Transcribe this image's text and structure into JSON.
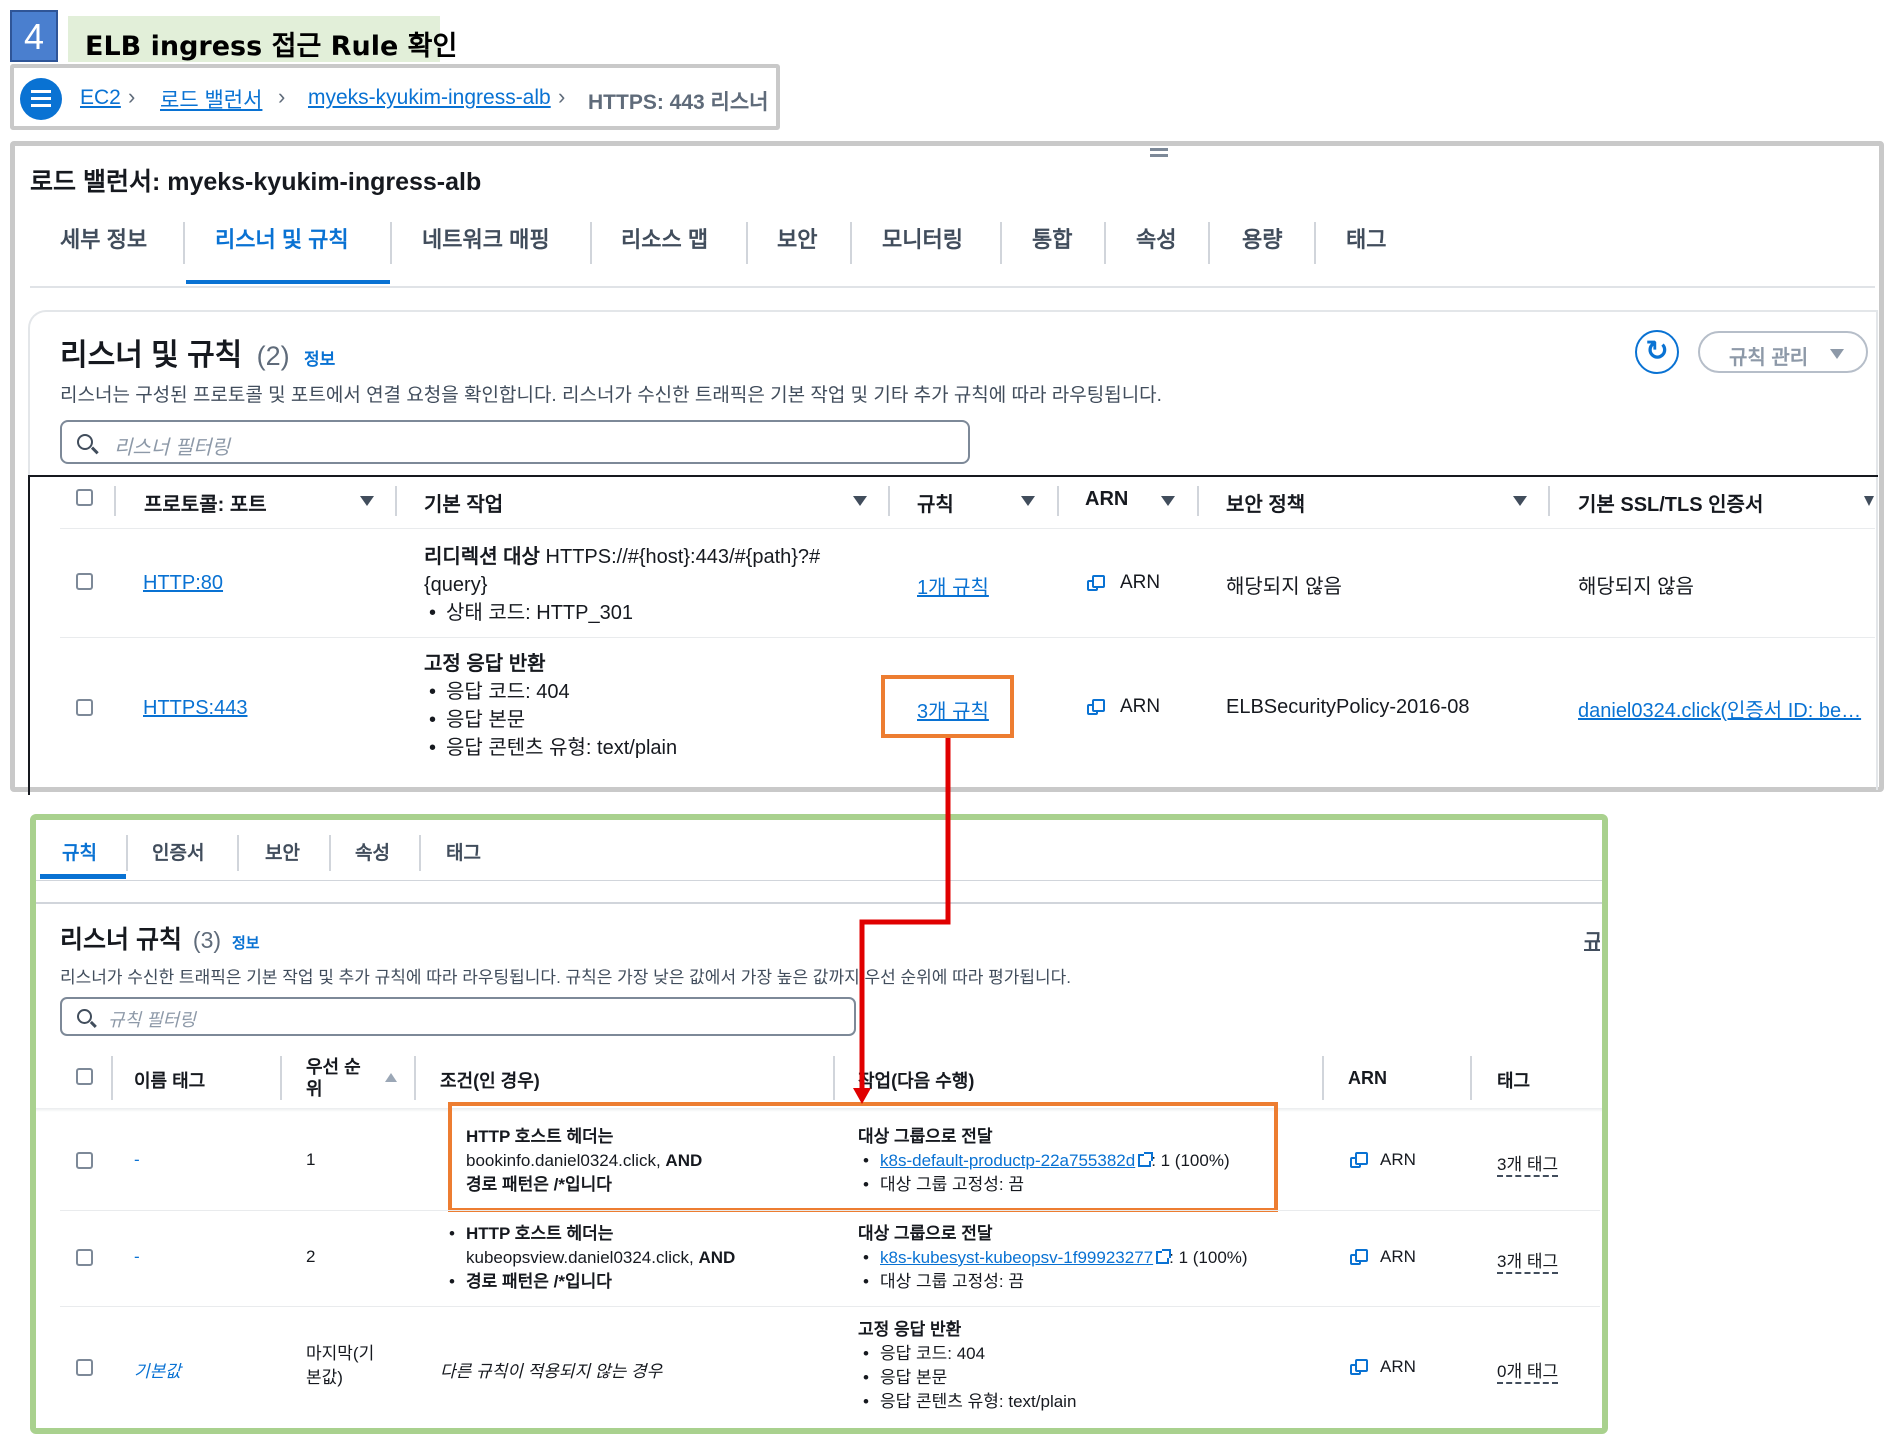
{
  "step": {
    "number": "4",
    "title": "ELB ingress 접근 Rule 확인"
  },
  "breadcrumb": {
    "items": [
      "EC2",
      "로드 밸런서",
      "myeks-kyukim-ingress-alb"
    ],
    "current": "HTTPS: 443 리스너"
  },
  "lb_panel": {
    "title": "로드 밸런서: myeks-kyukim-ingress-alb",
    "tabs": [
      "세부 정보",
      "리스너 및 규칙",
      "네트워크 매핑",
      "리소스 맵",
      "보안",
      "모니터링",
      "통합",
      "속성",
      "용량",
      "태그"
    ],
    "active_tab": "리스너 및 규칙"
  },
  "listeners": {
    "heading": "리스너 및 규칙",
    "count": "(2)",
    "info": "정보",
    "manage_button": "규칙 관리",
    "description": "리스너는 구성된 프로토콜 및 포트에서 연결 요청을 확인합니다. 리스너가 수신한 트래픽은 기본 작업 및 기타 추가 규칙에 따라 라우팅됩니다.",
    "filter_placeholder": "리스너 필터링",
    "columns": [
      "프로토콜: 포트",
      "기본 작업",
      "규칙",
      "ARN",
      "보안 정책",
      "기본 SSL/TLS 인증서"
    ],
    "rows": [
      {
        "protocol": "HTTP:80",
        "action_title": "리디렉션 대상",
        "action_target_1": "HTTPS://#{host}:443/#{path}?#",
        "action_target_2": "{query}",
        "action_items": [
          "상태 코드: HTTP_301"
        ],
        "rules": "1개 규칙",
        "arn": "ARN",
        "security_policy": "해당되지 않음",
        "certificate": "해당되지 않음"
      },
      {
        "protocol": "HTTPS:443",
        "action_title": "고정 응답 반환",
        "action_items": [
          "응답 코드: 404",
          "응답 본문",
          "응답 콘텐츠 유형: text/plain"
        ],
        "rules": "3개 규칙",
        "arn": "ARN",
        "security_policy": "ELBSecurityPolicy-2016-08",
        "certificate": "daniel0324.click(인증서 ID: be…"
      }
    ]
  },
  "rules_panel": {
    "tabs": [
      "규칙",
      "인증서",
      "보안",
      "속성",
      "태그"
    ],
    "active_tab": "규칙",
    "heading": "리스너 규칙",
    "count": "(3)",
    "info": "정보",
    "edge_label": "규",
    "description": "리스너가 수신한 트래픽은 기본 작업 및 추가 규칙에 따라 라우팅됩니다. 규칙은 가장 낮은 값에서 가장 높은 값까지 우선 순위에 따라 평가됩니다.",
    "filter_placeholder": "규칙 필터링",
    "columns": [
      "이름 태그",
      "우선 순위",
      "조건(인 경우)",
      "작업(다음 수행)",
      "ARN",
      "태그"
    ],
    "rows": [
      {
        "name": "-",
        "priority": "1",
        "cond_title": "HTTP 호스트 헤더는",
        "cond_host": "bookinfo.daniel0324.click,",
        "cond_and": "AND",
        "cond_path": "경로 패턴은 /*입니다",
        "action_title": "대상 그룹으로 전달",
        "target_group": "k8s-default-productp-22a755382d",
        "target_weight": ": 1 (100%)",
        "stickiness": "대상 그룹 고정성: 끔",
        "arn": "ARN",
        "tags": "3개 태그"
      },
      {
        "name": "-",
        "priority": "2",
        "cond_title": "HTTP 호스트 헤더는",
        "cond_host": "kubeopsview.daniel0324.click,",
        "cond_and": "AND",
        "cond_path": "경로 패턴은 /*입니다",
        "action_title": "대상 그룹으로 전달",
        "target_group": "k8s-kubesyst-kubeopsv-1f99923277",
        "target_weight": ": 1 (100%)",
        "stickiness": "대상 그룹 고정성: 끔",
        "arn": "ARN",
        "tags": "3개 태그"
      },
      {
        "name": "기본값",
        "priority_1": "마지막(기",
        "priority_2": "본값)",
        "condition": "다른 규칙이 적용되지 않는 경우",
        "action_title": "고정 응답 반환",
        "action_items": [
          "응답 코드: 404",
          "응답 본문",
          "응답 콘텐츠 유형: text/plain"
        ],
        "arn": "ARN",
        "tags": "0개 태그"
      }
    ]
  },
  "colors": {
    "link": "#0972d3",
    "highlight": "#ed7d31",
    "arrow": "#e00000",
    "green_frame": "#a9d18e",
    "step_badge": "#4a7fcf",
    "title_bg": "#e2efd9"
  }
}
